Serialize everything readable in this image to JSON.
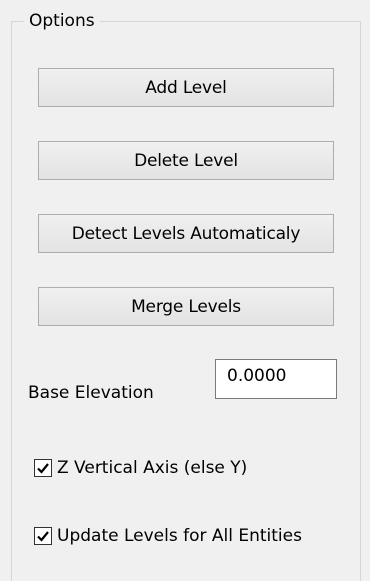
{
  "options": {
    "title": "Options",
    "buttons": {
      "add_level": "Add Level",
      "delete_level": "Delete Level",
      "detect_levels": "Detect Levels Automaticaly",
      "merge_levels": "Merge Levels"
    },
    "base_elevation": {
      "label": "Base Elevation",
      "value": "0.0000"
    },
    "z_vertical_axis": {
      "label": "Z Vertical Axis (else Y)",
      "checked": true
    },
    "update_levels": {
      "label": "Update Levels for All Entities",
      "checked": true
    }
  }
}
